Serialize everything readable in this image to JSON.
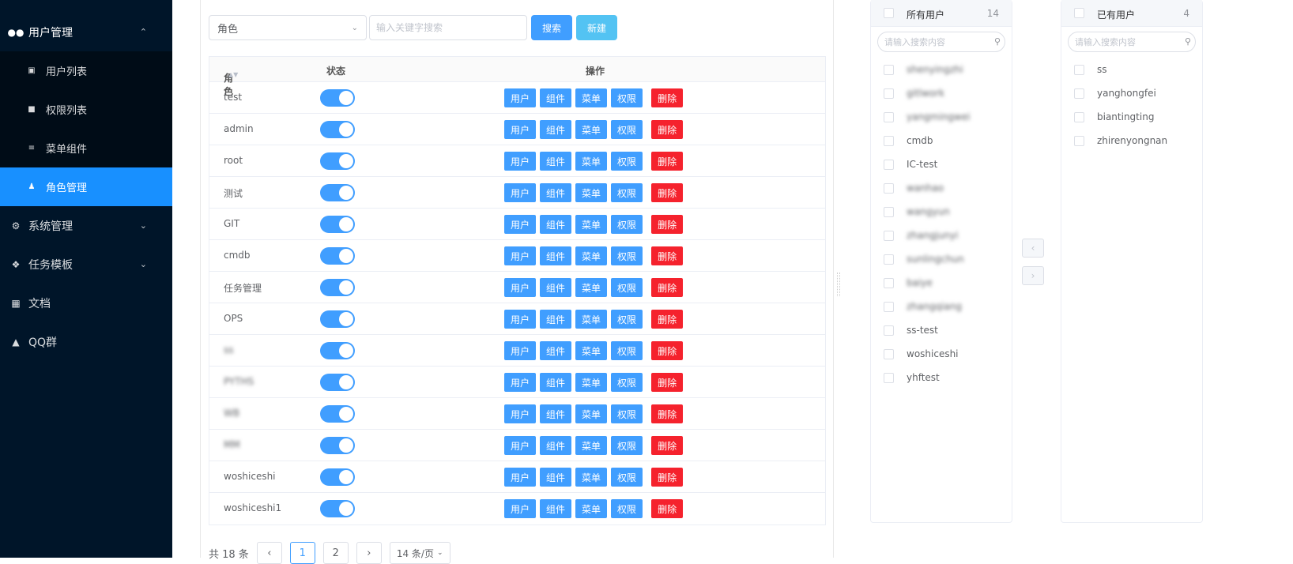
{
  "sidebar": {
    "items": [
      {
        "label": "用户管理",
        "icon": "users-icon",
        "chevron": "chevron-up-icon"
      },
      {
        "label": "用户列表",
        "icon": "user-list-icon"
      },
      {
        "label": "权限列表",
        "icon": "lock-icon"
      },
      {
        "label": "菜单组件",
        "icon": "menu-lines-icon"
      },
      {
        "label": "角色管理",
        "icon": "user-icon"
      },
      {
        "label": "系统管理",
        "icon": "gear-icon",
        "chevron": "chevron-down-icon"
      },
      {
        "label": "任务模板",
        "icon": "task-icon",
        "chevron": "chevron-down-icon"
      },
      {
        "label": "文档",
        "icon": "book-icon"
      },
      {
        "label": "QQ群",
        "icon": "bell-icon"
      }
    ]
  },
  "toolbar": {
    "select_value": "角色",
    "search_placeholder": "输入关键字搜索",
    "search_label": "搜索",
    "new_label": "新建"
  },
  "table": {
    "headers": {
      "role": "角色",
      "status": "状态",
      "actions": "操作"
    },
    "action_labels": {
      "user": "用户",
      "component": "组件",
      "menu": "菜单",
      "permission": "权限",
      "delete": "删除"
    },
    "rows": [
      {
        "name": "test",
        "enabled": true
      },
      {
        "name": "admin",
        "enabled": true
      },
      {
        "name": "root",
        "enabled": true
      },
      {
        "name": "测试",
        "enabled": true
      },
      {
        "name": "GIT",
        "enabled": true
      },
      {
        "name": "cmdb",
        "enabled": true
      },
      {
        "name": "任务管理",
        "enabled": true
      },
      {
        "name": "OPS",
        "enabled": true
      },
      {
        "name": "ss",
        "enabled": true,
        "blurred": true
      },
      {
        "name": "PYTHS",
        "enabled": true,
        "blurred": true
      },
      {
        "name": "WB",
        "enabled": true,
        "blurred": true
      },
      {
        "name": "MM",
        "enabled": true,
        "blurred": true
      },
      {
        "name": "woshiceshi",
        "enabled": true
      },
      {
        "name": "woshiceshi1",
        "enabled": true
      }
    ]
  },
  "pager": {
    "total": "共 18 条",
    "prev": "‹",
    "pages": [
      "1",
      "2"
    ],
    "next": "›",
    "page_size": "14 条/页"
  },
  "transfer": {
    "left": {
      "title": "所有用户",
      "count": "14",
      "placeholder": "请输入搜索内容",
      "items": [
        "shenyingzhi",
        "gitlwork",
        "yangmingwei",
        "cmdb",
        "IC-test",
        "wanhao",
        "wangyun",
        "zhangjunyi",
        "sunlingchun",
        "baiye",
        "zhangqiang",
        "ss-test",
        "woshiceshi",
        "yhftest"
      ]
    },
    "right": {
      "title": "已有用户",
      "count": "4",
      "placeholder": "请输入搜索内容",
      "items": [
        "ss",
        "yanghongfei",
        "biantingting",
        "zhirenyongnan"
      ]
    },
    "move_left": "‹",
    "move_right": "›"
  },
  "colors": {
    "sidebar_bg": "#001529",
    "active": "#1890ff",
    "primary": "#409eff",
    "danger": "#f5222d"
  }
}
